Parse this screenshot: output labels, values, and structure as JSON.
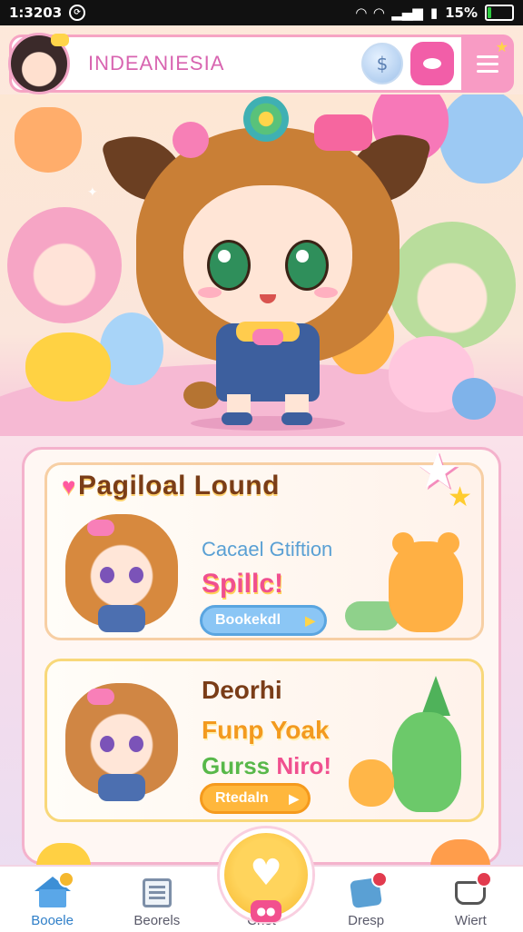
{
  "status_bar": {
    "time": "1:3203",
    "battery_percent": "15%",
    "battery_level": 0.15
  },
  "header": {
    "title": "INDEANIESIA",
    "globe_icon_glyph": "$",
    "menu_star": "★"
  },
  "cards": [
    {
      "title": "Pagiloal Lound",
      "subtitle": "Cacael Gtiftion",
      "highlight": "Spillc!",
      "button_label": "Bookekdl",
      "button_arrow": "▶"
    },
    {
      "title": "Deorhi",
      "line1": "Funp Yoak",
      "line2_a": "Gurss",
      "line2_b": "Niro!",
      "button_label": "Rtedaln",
      "button_arrow": "▶"
    }
  ],
  "bottom_nav": {
    "items": [
      {
        "label": "Booele",
        "icon": "home-icon",
        "active": true
      },
      {
        "label": "Beorels",
        "icon": "news-icon",
        "active": false
      },
      {
        "label": "Chet",
        "icon": "heart-icon",
        "active": false
      },
      {
        "label": "Dresp",
        "icon": "tools-icon",
        "active": false
      },
      {
        "label": "Wiert",
        "icon": "cart-icon",
        "active": false
      }
    ]
  },
  "colors": {
    "accent_pink": "#f25ea8",
    "accent_blue": "#5aa0d4",
    "accent_yellow": "#ffd45c"
  }
}
